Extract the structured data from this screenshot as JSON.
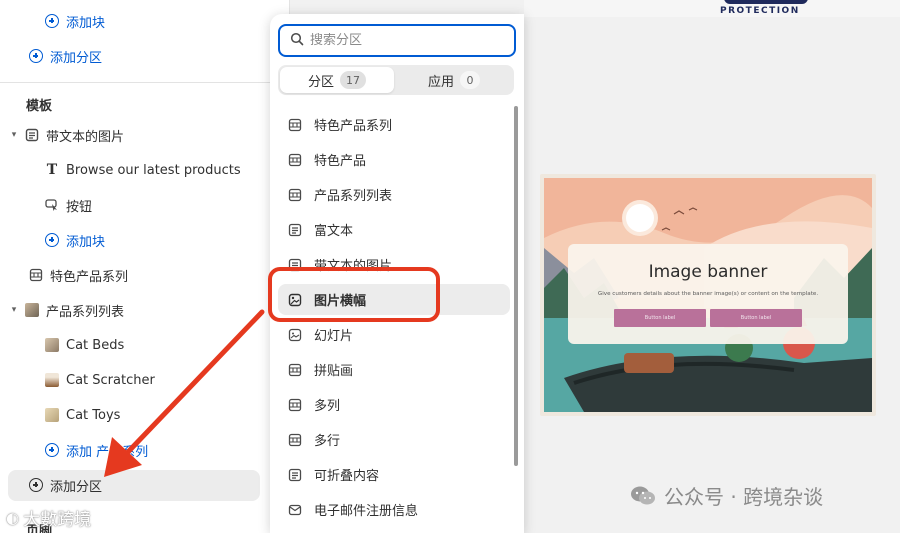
{
  "sidebar": {
    "add_block_top": "添加块",
    "add_section_top": "添加分区",
    "templates_heading": "模板",
    "image_with_text": "带文本的图片",
    "browse_text": "Browse our latest products",
    "button_item": "按钮",
    "add_block_mid": "添加块",
    "featured_collection": "特色产品系列",
    "collection_list": "产品系列列表",
    "cat_beds": "Cat Beds",
    "cat_scratcher": "Cat Scratcher",
    "cat_toys": "Cat Toys",
    "add_collection": "添加 产品系列",
    "add_section_bottom": "添加分区",
    "footer_heading": "页脚"
  },
  "popover": {
    "search_placeholder": "搜索分区",
    "tabs": [
      {
        "label": "分区",
        "count": "17"
      },
      {
        "label": "应用",
        "count": "0"
      }
    ],
    "sections": [
      {
        "label": "特色产品系列",
        "icon": "collection-icon"
      },
      {
        "label": "特色产品",
        "icon": "product-icon"
      },
      {
        "label": "产品系列列表",
        "icon": "collection-list-icon"
      },
      {
        "label": "富文本",
        "icon": "text-icon"
      },
      {
        "label": "带文本的图片",
        "icon": "image-text-icon"
      },
      {
        "label": "图片横幅",
        "icon": "image-icon",
        "active": true
      },
      {
        "label": "幻灯片",
        "icon": "slideshow-icon"
      },
      {
        "label": "拼贴画",
        "icon": "collage-icon"
      },
      {
        "label": "多列",
        "icon": "columns-icon"
      },
      {
        "label": "多行",
        "icon": "rows-icon"
      },
      {
        "label": "可折叠内容",
        "icon": "collapsible-icon"
      },
      {
        "label": "电子邮件注册信息",
        "icon": "email-icon"
      }
    ]
  },
  "preview": {
    "logo_text": "PROTECTION",
    "banner_title": "Image banner",
    "banner_desc": "Give customers details about the banner image(s) or content on the template.",
    "button1": "Button label",
    "button2": "Button label"
  },
  "watermarks": {
    "right": "公众号 · 跨境杂谈",
    "left": "大數跨境"
  },
  "colors": {
    "accent": "#005bd3",
    "annotation_red": "#e5391f",
    "banner_button": "#b9719a"
  }
}
